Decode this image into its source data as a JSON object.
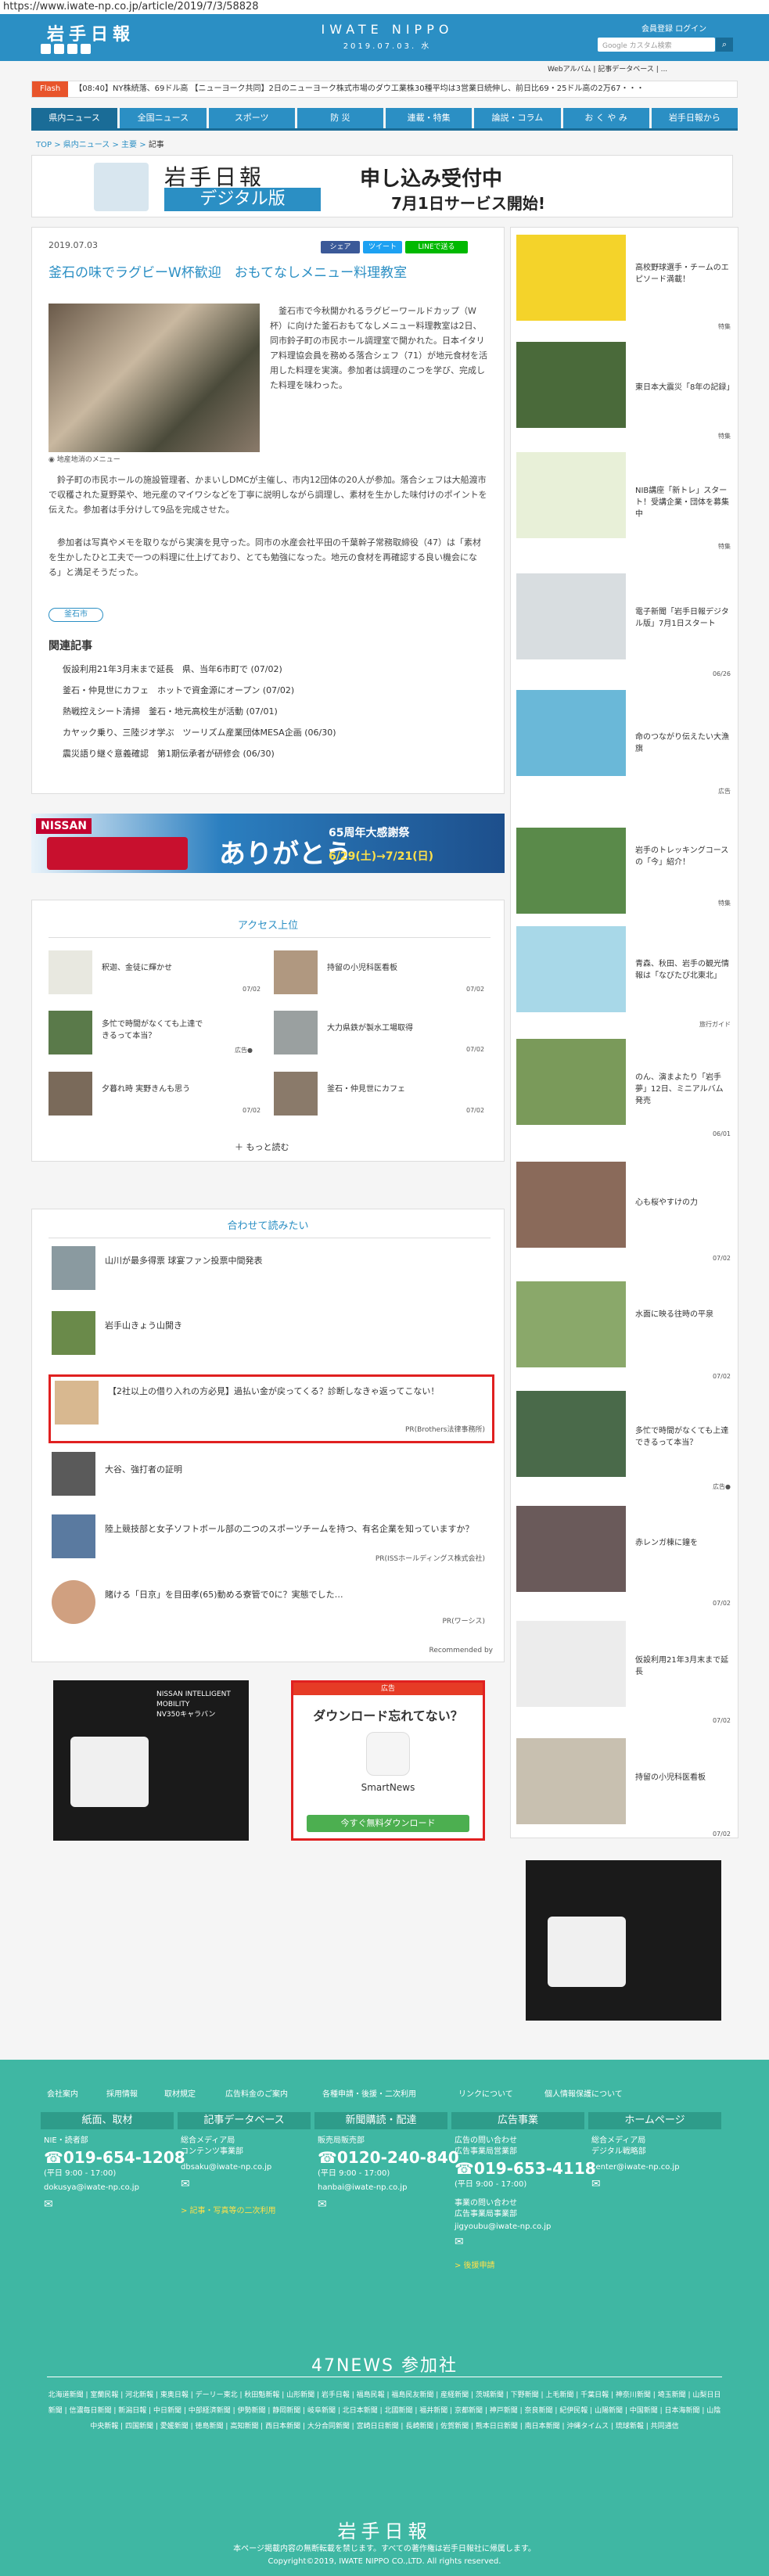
{
  "browser": {
    "url": "https://www.iwate-np.co.jp/article/2019/7/3/58828"
  },
  "header": {
    "logo": "岩手日報",
    "brand": "IWATE NIPPO",
    "date": "2019.07.03. 水",
    "member_links": "会員登録  ログイン",
    "search_placeholder": "Google カスタム検索",
    "subnav": "Webアルバム  |  記事データベース  |  ..."
  },
  "flash": {
    "label": "Flash",
    "text": "【08:40】NY株続落、69ドル高  【ニューヨーク共同】2日のニューヨーク株式市場のダウ工業株30種平均は3営業日続伸し、前日比69・25ドル高の2万67・・・"
  },
  "nav": [
    "県内ニュース",
    "全国ニュース",
    "スポーツ",
    "防 災",
    "連載・特集",
    "論説・コラム",
    "お く や み",
    "岩手日報から"
  ],
  "breadcrumb": {
    "top": "TOP",
    "sep": ">",
    "b2": "県内ニュース",
    "b3": "主要",
    "cur": "記事"
  },
  "banner": {
    "logo": "岩手日報",
    "digital": "デジタル版",
    "l1": "申し込み受付中",
    "l2": "7月1日サービス開始!"
  },
  "article": {
    "date": "2019.07.03",
    "share_fb": "シェア",
    "share_tw": "ツイート",
    "share_line": "LINEで送る",
    "title": "釜石の味でラグビーW杯歓迎　おもてなしメニュー料理教室",
    "caption": "地産地消のメニュー",
    "p1": "　釜石市で今秋開かれるラグビーワールドカップ（W杯）に向けた釜石おもてなしメニュー料理教室は2日、同市鈴子町の市民ホール調理室で開かれた。日本イタリア料理協会員を務める落合シェフ（71）が地元食材を活用した料理を実演。参加者は調理のこつを学び、完成した料理を味わった。",
    "p2": "　鈴子町の市民ホールの施設管理者、かまいしDMCが主催し、市内12団体の20人が参加。落合シェフは大船渡市で収穫された夏野菜や、地元産のマイワシなどを丁寧に説明しながら調理し、素材を生かした味付けのポイントを伝えた。参加者は手分けして9品を完成させた。",
    "p3": "　参加者は写真やメモを取りながら実演を見守った。同市の水産会社平田の千葉幹子常務取締役（47）は「素材を生かしたひと工夫で一つの料理に仕上げており、とても勉強になった。地元の食材を再確認する良い機会になる」と満足そうだった。",
    "tag": "釜石市",
    "related_h": "関連記事",
    "related": [
      "仮設利用21年3月末まで延長　県、当年6市町で (07/02)",
      "釜石・仲見世にカフェ　ホットで資金源にオープン (07/02)",
      "熱戦控えシート清掃　釜石・地元高校生が活動 (07/01)",
      "カヤック乗り、三陸ジオ学ぶ　ツーリズム産業団体MESA企画 (06/30)",
      "震災語り継ぐ意義確認　第1期伝承者が研修会 (06/30)"
    ]
  },
  "ad_nissan": {
    "logo": "NISSAN",
    "text": "ありがとう",
    "sub": "65周年大感謝祭",
    "dates": "6/29(土)→7/21(日)"
  },
  "ranking": {
    "title": "アクセス上位",
    "items": [
      {
        "text": "釈迦、金徒に輝かせ",
        "date": "07/02"
      },
      {
        "text": "持留の小児科医看板",
        "date": "07/02"
      },
      {
        "text": "多忙で時間がなくても上達できるって本当？",
        "date": "広告●"
      },
      {
        "text": "大力県鉄が製水工場取得",
        "date": "07/02"
      },
      {
        "text": "夕暮れ時 実野きんも思う",
        "date": "07/02"
      },
      {
        "text": "釜石・仲見世にカフェ",
        "date": "07/02"
      }
    ],
    "more": "もっと読む"
  },
  "recommend": {
    "title": "合わせて読みたい",
    "items": [
      {
        "text": "山川が最多得票 球宴ファン投票中間発表",
        "pr": ""
      },
      {
        "text": "岩手山きょう山開き",
        "pr": ""
      },
      {
        "text": "【2社以上の借り入れの方必見】過払い金が戻ってくる？診断しなきゃ返ってこない！",
        "pr": "PR(Brothers法律事務所)"
      },
      {
        "text": "大谷、強打者の証明",
        "pr": ""
      },
      {
        "text": "陸上競技部と女子ソフトボール部の二つのスポーツチームを持つ、有名企業を知っていますか？",
        "pr": "PR(ISSホールディングス株式会社)"
      },
      {
        "text": "賭ける「日京」を目田孝(65)動める寮管で0に？実態でした…",
        "pr": "PR(ワーシス)"
      }
    ],
    "powered": "Recommended by"
  },
  "ad_smartnews": {
    "top": "広告",
    "title": "ダウンロード忘れてない？",
    "name": "SmartNews",
    "btn": "今すぐ無料ダウンロード"
  },
  "sidebar": [
    {
      "text": "高校野球選手・チームのエピソード満載！",
      "date": "特集"
    },
    {
      "text": "東日本大震災「8年の記録」",
      "date": "特集"
    },
    {
      "text": "NIB講座「新トレ」スタート！受講企業・団体を募集中",
      "date": "特集"
    },
    {
      "text": "電子新聞「岩手日報デジタル版」7月1日スタート",
      "date": "06/26"
    },
    {
      "text": "命のつながり伝えたい大漁旗",
      "date": "広告"
    },
    {
      "text": "岩手のトレッキングコースの「今」紹介！",
      "date": "特集"
    },
    {
      "text": "青森、秋田、岩手の観光情報は「なびたび北東北」",
      "date": "旅行ガイド"
    },
    {
      "text": "のん、演まよたり「岩手夢」12日、ミニアルバム発売",
      "date": "06/01"
    },
    {
      "text": "心も桜やすけの力",
      "date": "07/02"
    },
    {
      "text": "水面に映る往時の平泉",
      "date": "07/02"
    },
    {
      "text": "多忙で時間がなくても上達できるって本当？",
      "date": "広告●"
    },
    {
      "text": "赤レンガ棟に鐘を",
      "date": "07/02"
    },
    {
      "text": "仮設利用21年3月末まで延長",
      "date": "07/02"
    },
    {
      "text": "持留の小児科医看板",
      "date": "07/02"
    }
  ],
  "footer": {
    "links": [
      "会社案内",
      "採用情報",
      "取材規定",
      "広告料金のご案内",
      "各種申請・後援・二次利用",
      "リンクについて",
      "個人情報保護について"
    ],
    "boxes": [
      {
        "h": "紙面、取材",
        "l1": "NIE・読者部",
        "phone": "019-654-1208",
        "l2": "(平日 9:00 - 17:00)",
        "l3": "dokusya@iwate-np.co.jp"
      },
      {
        "h": "記事データベース",
        "l1": "総合メディア局",
        "l2": "コンテンツ事業部",
        "l3": "dbsaku@iwate-np.co.jp",
        "l4": "> 記事・写真等の二次利用"
      },
      {
        "h": "新聞購読・配達",
        "l1": "販売局販売部",
        "phone": "0120-240-840",
        "l2": "(平日 9:00 - 17:00)",
        "l3": "hanbai@iwate-np.co.jp"
      },
      {
        "h": "広告事業",
        "l1": "広告の問い合わせ",
        "l2": "広告事業局営業部",
        "phone": "019-653-4118",
        "l3": "(平日 9:00 - 17:00)",
        "l4": "事業の問い合わせ",
        "l5": "広告事業局事業部",
        "l6": "jigyoubu@iwate-np.co.jp",
        "l7": "> 後援申請"
      },
      {
        "h": "ホームページ",
        "l1": "総合メディア局",
        "l2": "デジタル戦略部",
        "l3": "center@iwate-np.co.jp"
      }
    ],
    "n47": "47NEWS 参加社",
    "members": "北海道新聞 | 室蘭民報 | 河北新報 | 東奥日報 | デーリー東北 | 秋田魁新報 | 山形新聞 | 岩手日報 | 福島民報 | 福島民友新聞 | 産経新聞 | 茨城新聞 | 下野新聞 | 上毛新聞 | 千葉日報 | 神奈川新聞 | 埼玉新聞 | 山梨日日新聞 | 信濃毎日新聞 | 新潟日報 | 中日新聞 | 中部経済新聞 | 伊勢新聞 | 静岡新聞 | 岐阜新聞 | 北日本新聞 | 北國新聞 | 福井新聞 | 京都新聞 | 神戸新聞 | 奈良新聞 | 紀伊民報 | 山陽新聞 | 中国新聞 | 日本海新聞 | 山陰中央新報 | 四国新聞 | 愛媛新聞 | 徳島新聞 | 高知新聞 | 西日本新聞 | 大分合同新聞 | 宮崎日日新聞 | 長崎新聞 | 佐賀新聞 | 熊本日日新聞 | 南日本新聞 | 沖縄タイムス | 琉球新報 | 共同通信",
    "logo": "岩手日報",
    "notice": "本ページ掲載内容の無断転載を禁じます。すべての著作権は岩手日報社に帰属します。",
    "copyright": "Copyright©2019, IWATE NIPPO CO.,LTD. All rights reserved."
  },
  "colors": {
    "primary": "#2b8fc4",
    "dark": "#1a6c97",
    "footer": "#3fb7a3",
    "red": "#e02020"
  }
}
